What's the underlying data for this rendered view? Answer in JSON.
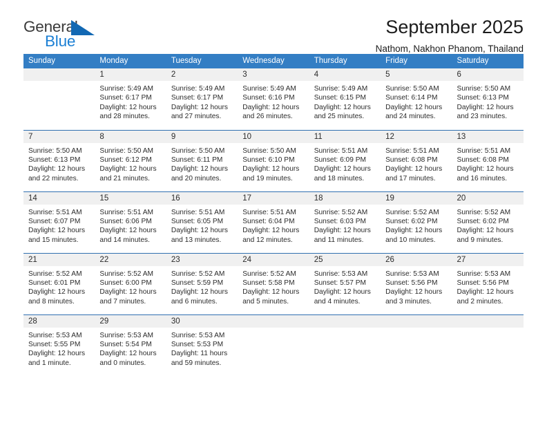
{
  "logo": {
    "name_part1": "General",
    "name_part2": "Blue",
    "icon": "triangle-icon",
    "accent_color": "#1268b3",
    "blue_text_color": "#1b7fd4"
  },
  "header": {
    "month_title": "September 2025",
    "location": "Nathom, Nakhon Phanom, Thailand",
    "header_bg_color": "#337ec4",
    "week_separator_color": "#2f6fb0",
    "daynum_band_color": "#f0f0f0"
  },
  "weekdays": [
    "Sunday",
    "Monday",
    "Tuesday",
    "Wednesday",
    "Thursday",
    "Friday",
    "Saturday"
  ],
  "labels": {
    "sunrise": "Sunrise:",
    "sunset": "Sunset:",
    "daylight": "Daylight:"
  },
  "weeks": [
    [
      {
        "day": "",
        "empty": true
      },
      {
        "day": "1",
        "sunrise": "Sunrise: 5:49 AM",
        "sunset": "Sunset: 6:17 PM",
        "daylight": "Daylight: 12 hours and 28 minutes."
      },
      {
        "day": "2",
        "sunrise": "Sunrise: 5:49 AM",
        "sunset": "Sunset: 6:17 PM",
        "daylight": "Daylight: 12 hours and 27 minutes."
      },
      {
        "day": "3",
        "sunrise": "Sunrise: 5:49 AM",
        "sunset": "Sunset: 6:16 PM",
        "daylight": "Daylight: 12 hours and 26 minutes."
      },
      {
        "day": "4",
        "sunrise": "Sunrise: 5:49 AM",
        "sunset": "Sunset: 6:15 PM",
        "daylight": "Daylight: 12 hours and 25 minutes."
      },
      {
        "day": "5",
        "sunrise": "Sunrise: 5:50 AM",
        "sunset": "Sunset: 6:14 PM",
        "daylight": "Daylight: 12 hours and 24 minutes."
      },
      {
        "day": "6",
        "sunrise": "Sunrise: 5:50 AM",
        "sunset": "Sunset: 6:13 PM",
        "daylight": "Daylight: 12 hours and 23 minutes."
      }
    ],
    [
      {
        "day": "7",
        "sunrise": "Sunrise: 5:50 AM",
        "sunset": "Sunset: 6:13 PM",
        "daylight": "Daylight: 12 hours and 22 minutes."
      },
      {
        "day": "8",
        "sunrise": "Sunrise: 5:50 AM",
        "sunset": "Sunset: 6:12 PM",
        "daylight": "Daylight: 12 hours and 21 minutes."
      },
      {
        "day": "9",
        "sunrise": "Sunrise: 5:50 AM",
        "sunset": "Sunset: 6:11 PM",
        "daylight": "Daylight: 12 hours and 20 minutes."
      },
      {
        "day": "10",
        "sunrise": "Sunrise: 5:50 AM",
        "sunset": "Sunset: 6:10 PM",
        "daylight": "Daylight: 12 hours and 19 minutes."
      },
      {
        "day": "11",
        "sunrise": "Sunrise: 5:51 AM",
        "sunset": "Sunset: 6:09 PM",
        "daylight": "Daylight: 12 hours and 18 minutes."
      },
      {
        "day": "12",
        "sunrise": "Sunrise: 5:51 AM",
        "sunset": "Sunset: 6:08 PM",
        "daylight": "Daylight: 12 hours and 17 minutes."
      },
      {
        "day": "13",
        "sunrise": "Sunrise: 5:51 AM",
        "sunset": "Sunset: 6:08 PM",
        "daylight": "Daylight: 12 hours and 16 minutes."
      }
    ],
    [
      {
        "day": "14",
        "sunrise": "Sunrise: 5:51 AM",
        "sunset": "Sunset: 6:07 PM",
        "daylight": "Daylight: 12 hours and 15 minutes."
      },
      {
        "day": "15",
        "sunrise": "Sunrise: 5:51 AM",
        "sunset": "Sunset: 6:06 PM",
        "daylight": "Daylight: 12 hours and 14 minutes."
      },
      {
        "day": "16",
        "sunrise": "Sunrise: 5:51 AM",
        "sunset": "Sunset: 6:05 PM",
        "daylight": "Daylight: 12 hours and 13 minutes."
      },
      {
        "day": "17",
        "sunrise": "Sunrise: 5:51 AM",
        "sunset": "Sunset: 6:04 PM",
        "daylight": "Daylight: 12 hours and 12 minutes."
      },
      {
        "day": "18",
        "sunrise": "Sunrise: 5:52 AM",
        "sunset": "Sunset: 6:03 PM",
        "daylight": "Daylight: 12 hours and 11 minutes."
      },
      {
        "day": "19",
        "sunrise": "Sunrise: 5:52 AM",
        "sunset": "Sunset: 6:02 PM",
        "daylight": "Daylight: 12 hours and 10 minutes."
      },
      {
        "day": "20",
        "sunrise": "Sunrise: 5:52 AM",
        "sunset": "Sunset: 6:02 PM",
        "daylight": "Daylight: 12 hours and 9 minutes."
      }
    ],
    [
      {
        "day": "21",
        "sunrise": "Sunrise: 5:52 AM",
        "sunset": "Sunset: 6:01 PM",
        "daylight": "Daylight: 12 hours and 8 minutes."
      },
      {
        "day": "22",
        "sunrise": "Sunrise: 5:52 AM",
        "sunset": "Sunset: 6:00 PM",
        "daylight": "Daylight: 12 hours and 7 minutes."
      },
      {
        "day": "23",
        "sunrise": "Sunrise: 5:52 AM",
        "sunset": "Sunset: 5:59 PM",
        "daylight": "Daylight: 12 hours and 6 minutes."
      },
      {
        "day": "24",
        "sunrise": "Sunrise: 5:52 AM",
        "sunset": "Sunset: 5:58 PM",
        "daylight": "Daylight: 12 hours and 5 minutes."
      },
      {
        "day": "25",
        "sunrise": "Sunrise: 5:53 AM",
        "sunset": "Sunset: 5:57 PM",
        "daylight": "Daylight: 12 hours and 4 minutes."
      },
      {
        "day": "26",
        "sunrise": "Sunrise: 5:53 AM",
        "sunset": "Sunset: 5:56 PM",
        "daylight": "Daylight: 12 hours and 3 minutes."
      },
      {
        "day": "27",
        "sunrise": "Sunrise: 5:53 AM",
        "sunset": "Sunset: 5:56 PM",
        "daylight": "Daylight: 12 hours and 2 minutes."
      }
    ],
    [
      {
        "day": "28",
        "sunrise": "Sunrise: 5:53 AM",
        "sunset": "Sunset: 5:55 PM",
        "daylight": "Daylight: 12 hours and 1 minute."
      },
      {
        "day": "29",
        "sunrise": "Sunrise: 5:53 AM",
        "sunset": "Sunset: 5:54 PM",
        "daylight": "Daylight: 12 hours and 0 minutes."
      },
      {
        "day": "30",
        "sunrise": "Sunrise: 5:53 AM",
        "sunset": "Sunset: 5:53 PM",
        "daylight": "Daylight: 11 hours and 59 minutes."
      },
      {
        "day": "",
        "empty": true
      },
      {
        "day": "",
        "empty": true
      },
      {
        "day": "",
        "empty": true
      },
      {
        "day": "",
        "empty": true
      }
    ]
  ]
}
